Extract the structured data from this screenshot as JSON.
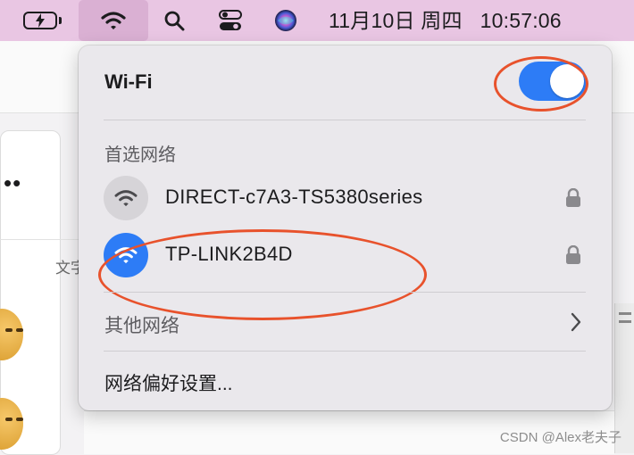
{
  "menubar": {
    "icons": [
      "battery-charging-icon",
      "wifi-icon",
      "search-icon",
      "control-center-icon",
      "siri-icon"
    ],
    "date": "11月10日 周四",
    "time": "10:57:06"
  },
  "background": {
    "partial_text": "文字",
    "watermark": "CSDN @Alex老夫子"
  },
  "wifi_panel": {
    "title": "Wi-Fi",
    "enabled": true,
    "preferred_section": "首选网络",
    "networks": [
      {
        "name": "DIRECT-c7A3-TS5380series",
        "connected": false,
        "locked": true
      },
      {
        "name": "TP-LINK2B4D",
        "connected": true,
        "locked": true
      }
    ],
    "other_networks": "其他网络",
    "preferences": "网络偏好设置..."
  },
  "colors": {
    "menubar": "#e9c6e3",
    "accent": "#2d7cf6",
    "annotation": "#e8522c"
  }
}
